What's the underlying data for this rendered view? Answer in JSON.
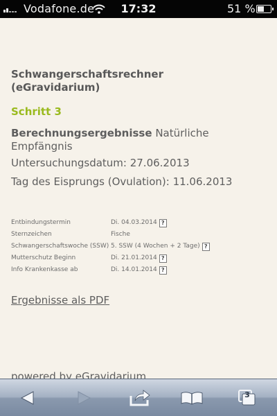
{
  "status_bar": {
    "carrier": "Vodafone.de",
    "time": "17:32",
    "battery_percent": "51 %",
    "battery_level": 0.51
  },
  "page": {
    "title": "Schwangerschaftsrechner (eGravidarium)",
    "step": "Schritt 3",
    "results_heading_bold": "Berechnungsergebnisse",
    "results_heading_rest": "Natürliche Empfängnis",
    "exam_date": "Untersuchungsdatum: 27.06.2013",
    "ovulation": "Tag des Eisprungs (Ovulation): 11.06.2013",
    "details": [
      {
        "label": "Entbindungstermin",
        "value": "Di. 04.03.2014",
        "help": "?"
      },
      {
        "label": "Sternzeichen",
        "value": "Fische"
      },
      {
        "label": "Schwangerschaftswoche (SSW)",
        "value": "5. SSW (4 Wochen + 2 Tage)",
        "help": "?"
      },
      {
        "label": "Mutterschutz Beginn",
        "value": "Di. 21.01.2014",
        "help": "?"
      },
      {
        "label": "Info Krankenkasse ab",
        "value": "Di. 14.01.2014",
        "help": "?"
      }
    ],
    "pdf_link": "Ergebnisse als PDF",
    "powered_by": "powered by eGravidarium"
  },
  "toolbar": {
    "tabs_count": "3"
  },
  "colors": {
    "accent_green": "#9aba1e",
    "text_gray": "#5e5e5e",
    "page_background": "#f6f2ea"
  }
}
